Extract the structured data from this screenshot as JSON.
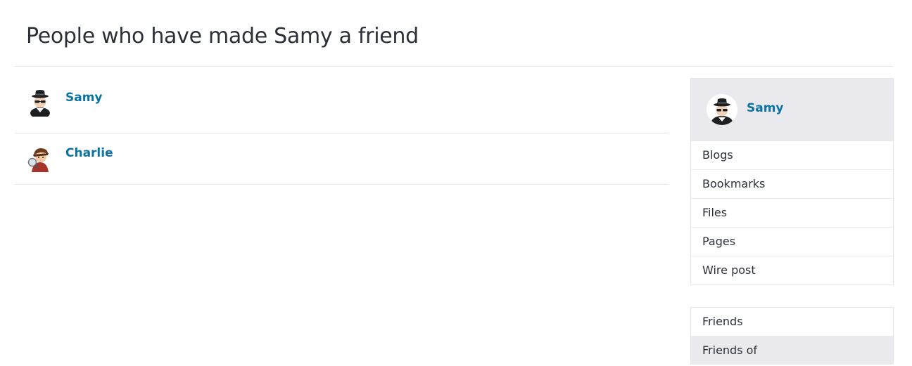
{
  "page": {
    "title": "People who have made Samy a friend"
  },
  "members": [
    {
      "name": "Samy",
      "avatar": "spy-avatar-icon"
    },
    {
      "name": "Charlie",
      "avatar": "detective-avatar-icon"
    }
  ],
  "owner": {
    "name": "Samy",
    "avatar": "spy-avatar-icon",
    "menu": [
      "Blogs",
      "Bookmarks",
      "Files",
      "Pages",
      "Wire post"
    ]
  },
  "friends_menu": {
    "items": [
      "Friends",
      "Friends of"
    ],
    "active": "Friends of"
  },
  "colors": {
    "link": "#0b73a1",
    "active_bg": "#e9e9ee",
    "border": "#e6e6e6"
  }
}
